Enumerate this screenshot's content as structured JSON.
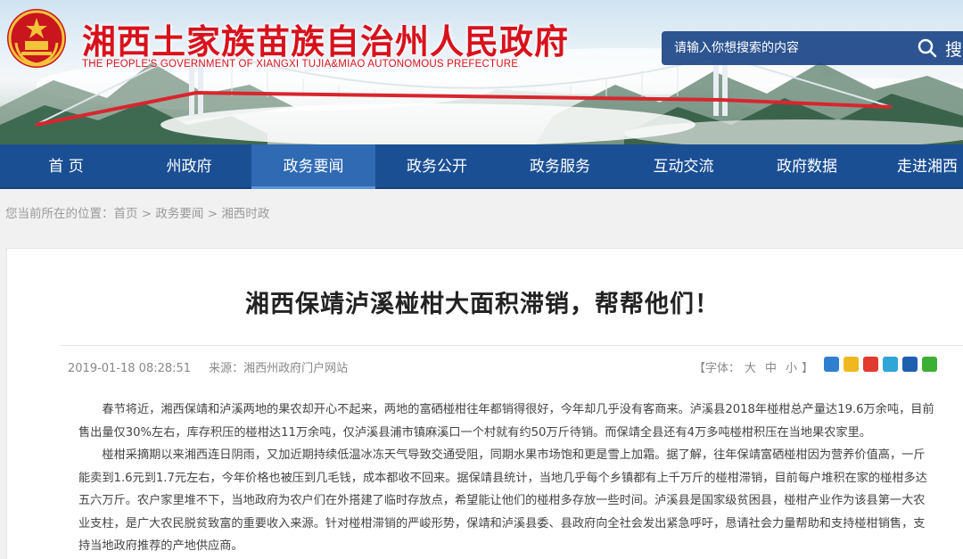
{
  "header": {
    "title": "湘西土家族苗族自治州人民政府",
    "subtitle": "THE PEOPLE'S GOVERNMENT OF XIANGXI TUJIA&MIAO AUTONOMOUS PREFECTURE",
    "search_placeholder": "请输入你想搜索的内容",
    "search_button": "搜"
  },
  "nav": {
    "items": [
      {
        "label": "首 页"
      },
      {
        "label": "州政府"
      },
      {
        "label": "政务要闻"
      },
      {
        "label": "政务公开"
      },
      {
        "label": "政务服务"
      },
      {
        "label": "互动交流"
      },
      {
        "label": "政府数据"
      },
      {
        "label": "走进湘西"
      }
    ],
    "active_index": 2,
    "color": "#1b4f94"
  },
  "breadcrumb": {
    "prefix": "您当前所在的位置：",
    "items": [
      "首页",
      "政务要闻",
      "湘西时政"
    ],
    "separator": ">"
  },
  "article": {
    "title": "湘西保靖泸溪椪柑大面积滞销，帮帮他们！",
    "date": "2019-01-18 08:28:51",
    "source": "来源：湘西州政府门户网站",
    "font_label_open": "【字体：",
    "font_sizes": [
      "大",
      "中",
      "小"
    ],
    "font_label_close": "】",
    "share_icons": [
      "qzone-icon",
      "wechat-moments-icon",
      "weibo-icon",
      "tencent-icon",
      "renren-icon",
      "wechat-icon"
    ],
    "paragraphs": [
      "春节将近，湘西保靖和泸溪两地的果农却开心不起来，两地的富硒椪柑往年都销得很好，今年却几乎没有客商来。泸溪县2018年椪柑总产量达19.6万余吨，目前售出量仅30%左右，库存积压的椪柑达11万余吨，仅泸溪县浦市镇麻溪口一个村就有约50万斤待销。而保靖全县还有4万多吨椪柑积压在当地果农家里。",
      "椪柑采摘期以来湘西连日阴雨，又加近期持续低温冰冻天气导致交通受阻，同期水果市场饱和更是雪上加霜。据了解，往年保靖富硒椪柑因为营养价值高，一斤能卖到1.6元到1.7元左右，今年价格也被压到几毛钱，成本都收不回来。据保靖县统计，当地几乎每个乡镇都有上千万斤的椪柑滞销，目前每户堆积在家的椪柑多达五六万斤。农户家里堆不下，当地政府为农户们在外搭建了临时存放点，希望能让他们的椪柑多存放一些时间。泸溪县是国家级贫困县，椪柑产业作为该县第一大农业支柱，是广大农民脱贫致富的重要收入来源。针对椪柑滞销的严峻形势，保靖和泸溪县委、县政府向全社会发出紧急呼吁，恳请社会力量帮助和支持椪柑销售，支持当地政府推荐的产地供应商。"
    ]
  },
  "colors": {
    "title_red": "#d7121c",
    "nav_blue": "#1b4f94",
    "nav_active": "#2f6ab3",
    "search_bg": "#1c4687"
  }
}
